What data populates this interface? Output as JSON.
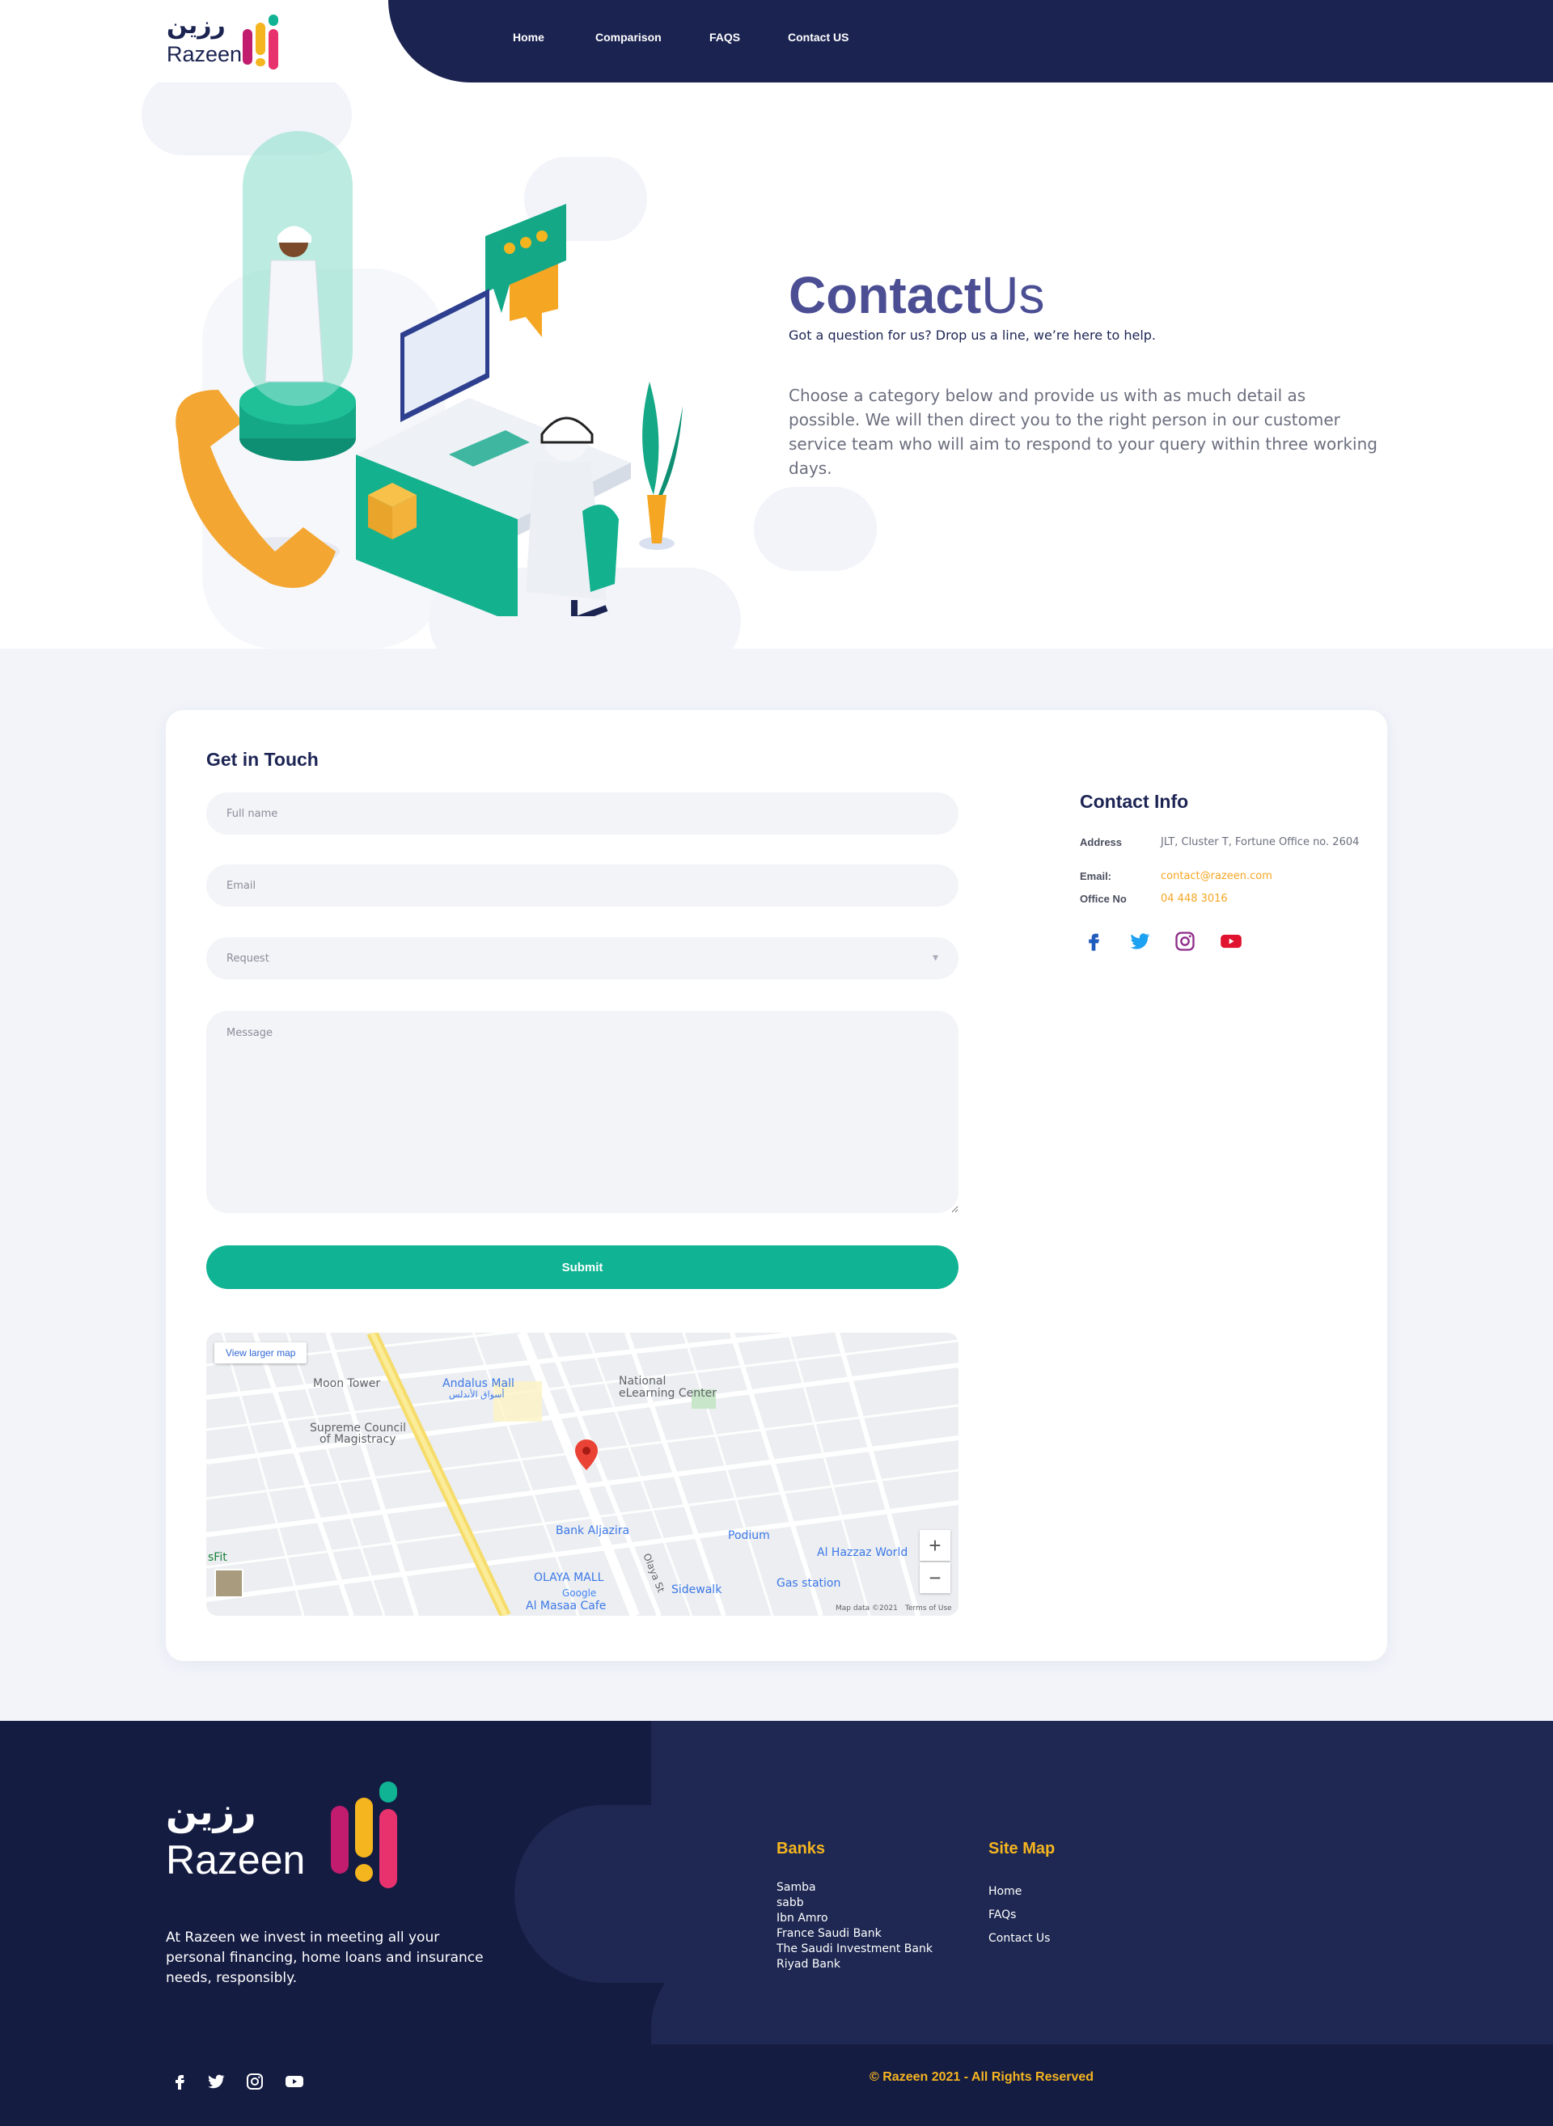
{
  "brand": {
    "name_en": "Razeen",
    "name_ar": "رزين",
    "colors": {
      "navy": "#1b2351",
      "teal": "#10b393",
      "amber": "#f5b51f",
      "purple": "#4b4e93"
    }
  },
  "nav": {
    "items": [
      "Home",
      "Comparison",
      "FAQS",
      "Contact US"
    ]
  },
  "hero": {
    "title_bold": "Contact",
    "title_light": "Us",
    "subtitle": "Got a question for us? Drop us a line, we’re here to help.",
    "body": "Choose a category below and provide us with as much detail as possible. We will then direct you to the right person in our customer service team who will aim to respond to your query within three working days."
  },
  "form": {
    "title": "Get in Touch",
    "fullname_placeholder": "Full name",
    "email_placeholder": "Email",
    "request_placeholder": "Request",
    "message_placeholder": "Message",
    "submit_label": "Submit"
  },
  "contact_info": {
    "title": "Contact Info",
    "address_label": "Address",
    "address": "JLT, Cluster T, Fortune Office no. 2604",
    "email_label": "Email:",
    "email": "contact@razeen.com",
    "office_label": "Office No",
    "office": "04 448 3016",
    "social": [
      "facebook-icon",
      "twitter-icon",
      "instagram-icon",
      "youtube-icon"
    ]
  },
  "map": {
    "view_larger": "View larger map",
    "labels": {
      "moon_tower": "Moon Tower",
      "andalus_mall": "Andalus Mall",
      "andalus_mall_ar": "أسواق الأندلس",
      "national": "National",
      "elearning": "eLearning Center",
      "supreme1": "Supreme Council",
      "supreme2": "of Magistracy",
      "bank": "Bank Aljazira",
      "podium": "Podium",
      "alhazzaz": "Al Hazzaz World",
      "gas": "Gas station",
      "olaya": "OLAYA MALL",
      "almasaa": "Al Masaa Cafe",
      "sidewalk": "Sidewalk",
      "olaya_st": "Olaya St",
      "fit": "sFit",
      "google": "Google",
      "mapdata": "Map data ©2021",
      "terms": "Terms of Use"
    },
    "zoom_in": "+",
    "zoom_out": "−"
  },
  "footer": {
    "about": "At Razeen we invest in meeting all your personal financing, home loans and insurance needs, responsibly.",
    "banks_title": "Banks",
    "banks": [
      "Samba",
      "sabb",
      "Ibn Amro",
      "France Saudi Bank",
      "The Saudi Investment Bank",
      "Riyad Bank"
    ],
    "sitemap_title": "Site Map",
    "sitemap": [
      "Home",
      "FAQs",
      "Contact Us"
    ],
    "copyright": "© Razeen 2021 - All Rights Reserved",
    "social": [
      "facebook-icon",
      "twitter-icon",
      "instagram-icon",
      "youtube-icon"
    ]
  }
}
